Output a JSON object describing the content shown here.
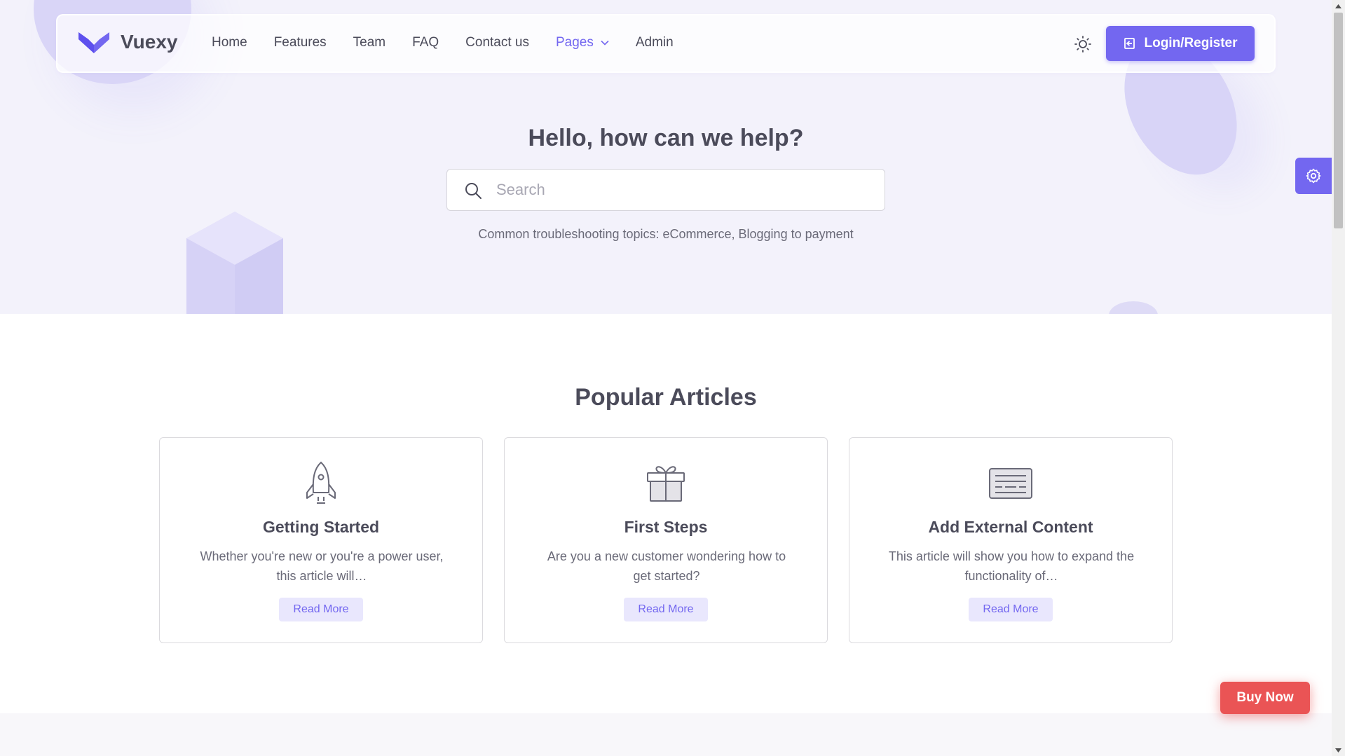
{
  "brand": {
    "name": "Vuexy",
    "accent_color": "#7367f0"
  },
  "nav": {
    "links": [
      {
        "label": "Home"
      },
      {
        "label": "Features"
      },
      {
        "label": "Team"
      },
      {
        "label": "FAQ"
      },
      {
        "label": "Contact us"
      },
      {
        "label": "Pages",
        "active": true,
        "has_dropdown": true
      },
      {
        "label": "Admin"
      }
    ],
    "theme_icon": "sun-icon",
    "login_label": "Login/Register",
    "login_icon": "login-icon"
  },
  "hero": {
    "title": "Hello, how can we help?",
    "search_placeholder": "Search",
    "search_value": "",
    "subtitle": "Common troubleshooting topics: eCommerce, Blogging to payment"
  },
  "articles": {
    "title": "Popular Articles",
    "items": [
      {
        "icon": "rocket-icon",
        "title": "Getting Started",
        "desc_line1": "Whether you're new or you're a power user,",
        "desc_line2": "this article will…",
        "button": "Read More"
      },
      {
        "icon": "gift-icon",
        "title": "First Steps",
        "desc_line1": "Are you a new customer wondering how to",
        "desc_line2": "get started?",
        "button": "Read More"
      },
      {
        "icon": "keyboard-icon",
        "title": "Add External Content",
        "desc_line1": "This article will show you how to expand the",
        "desc_line2": "functionality of…",
        "button": "Read More"
      }
    ]
  },
  "buy_now": {
    "label": "Buy Now",
    "color": "#ea5455"
  },
  "settings_icon": "gear-icon"
}
